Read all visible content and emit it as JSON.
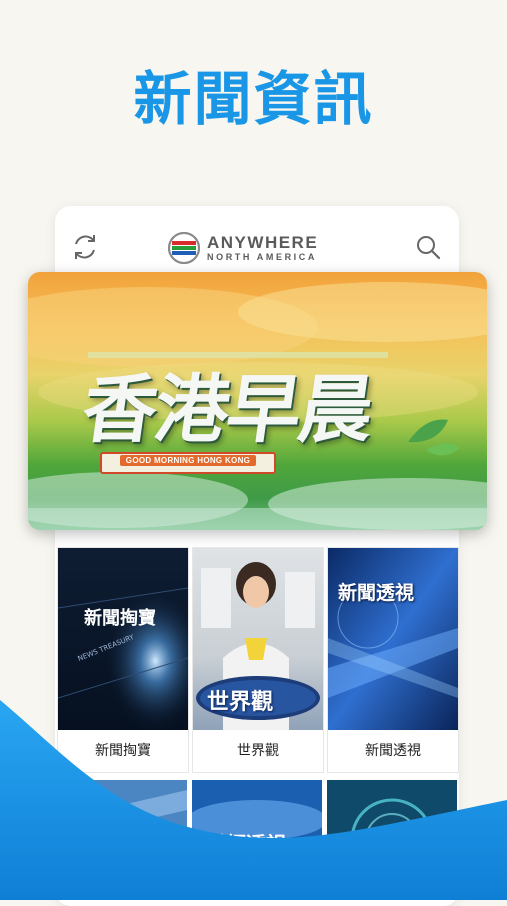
{
  "headline": "新聞資訊",
  "brand": {
    "line1": "ANYWHERE",
    "line2": "NORTH AMERICA"
  },
  "icons": {
    "refresh": "refresh-icon",
    "search": "search-icon",
    "logo": "tvb-logo-icon"
  },
  "hero": {
    "title": "香港早晨",
    "subtitle": "GOOD MORNING HONG KONG"
  },
  "programs": [
    {
      "label": "新聞掏寶",
      "thumb_title": "新聞掏寶",
      "thumb_sub": "NEWS TREASURY"
    },
    {
      "label": "世界觀",
      "thumb_title": "世界觀"
    },
    {
      "label": "新聞透視",
      "thumb_title": "新聞透視"
    }
  ],
  "programs_row2": [
    {
      "thumb_title": ""
    },
    {
      "thumb_title": "財經透視"
    },
    {
      "thumb_title": ""
    }
  ],
  "colors": {
    "headline": "#1a96e6",
    "wave": "#1a8fe0",
    "background": "#f8f6f0"
  }
}
